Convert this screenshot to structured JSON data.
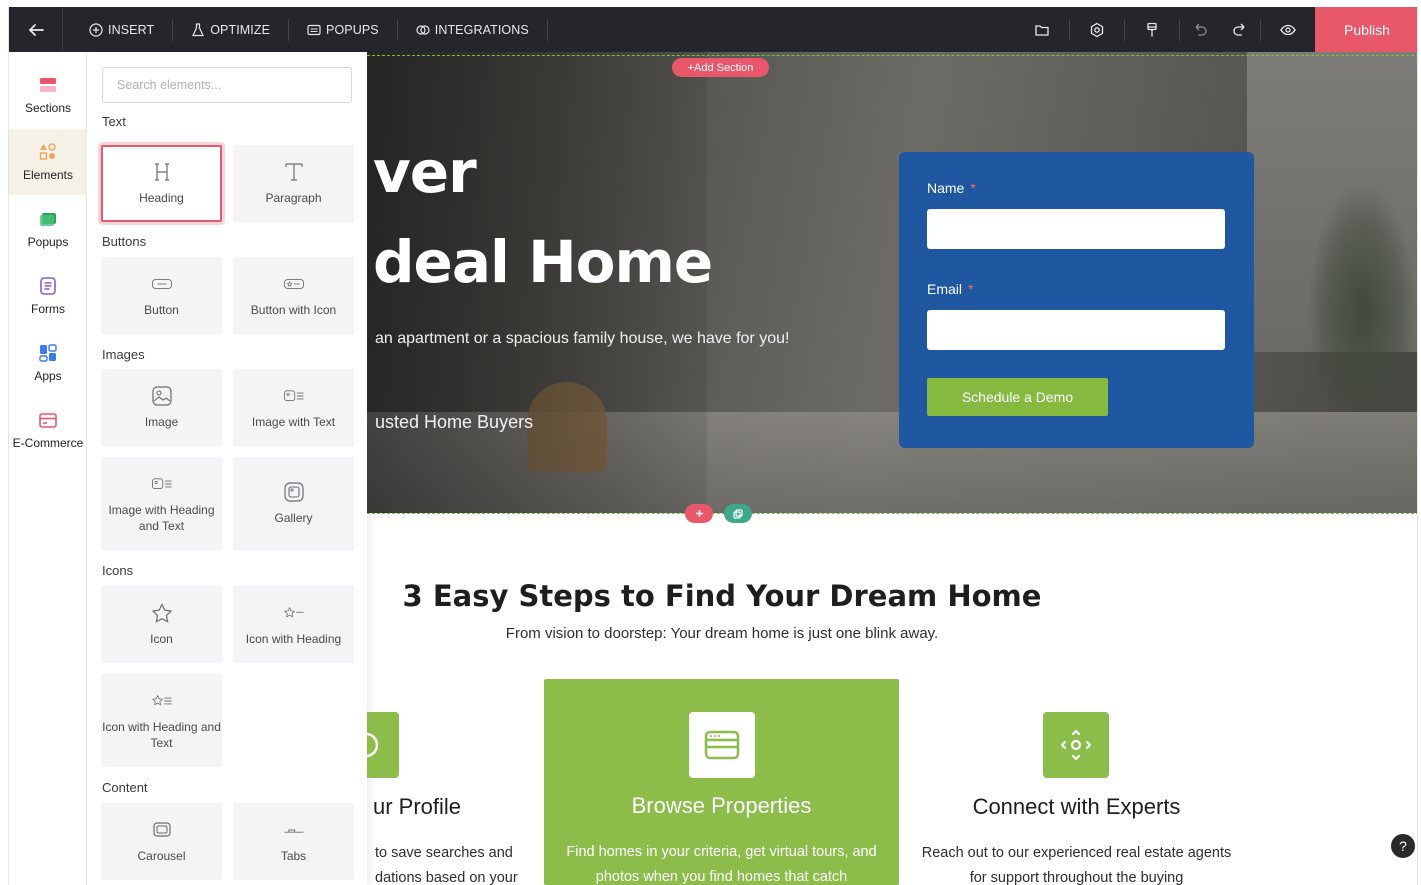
{
  "topbar": {
    "back_icon": "arrow-left-icon",
    "nav": [
      {
        "label": "INSERT",
        "icon": "plus-circle-icon"
      },
      {
        "label": "OPTIMIZE",
        "icon": "flask-icon"
      },
      {
        "label": "POPUPS",
        "icon": "window-icon"
      },
      {
        "label": "INTEGRATIONS",
        "icon": "link-icon"
      }
    ],
    "tools": [
      "folder-icon",
      "settings-icon",
      "paint-brush-icon",
      "undo-icon",
      "redo-icon",
      "eye-icon"
    ],
    "publish_label": "Publish",
    "accent": "#e8586a"
  },
  "rail": {
    "items": [
      {
        "label": "Sections",
        "icon": "sections-icon"
      },
      {
        "label": "Elements",
        "icon": "shapes-icon",
        "active": true
      },
      {
        "label": "Popups",
        "icon": "popups-icon"
      },
      {
        "label": "Forms",
        "icon": "forms-icon"
      },
      {
        "label": "Apps",
        "icon": "apps-icon"
      },
      {
        "label": "E-Commerce",
        "icon": "ecommerce-icon"
      }
    ]
  },
  "panel": {
    "search_placeholder": "Search elements...",
    "categories": {
      "text": "Text",
      "buttons": "Buttons",
      "images": "Images",
      "icons": "Icons",
      "content": "Content"
    },
    "elements": {
      "heading": "Heading",
      "paragraph": "Paragraph",
      "button": "Button",
      "button_icon": "Button with Icon",
      "image": "Image",
      "image_text": "Image with Text",
      "image_heading_text": "Image with Heading and Text",
      "gallery": "Gallery",
      "icon": "Icon",
      "icon_heading": "Icon with Heading",
      "icon_heading_text": "Icon with Heading and Text",
      "carousel": "Carousel",
      "tabs": "Tabs"
    }
  },
  "canvas": {
    "add_section_label": "+Add Section",
    "hero": {
      "line1": "ver",
      "line2": "deal Home",
      "subtitle": "an apartment or a spacious family house, we have for you!",
      "trust": "usted Home Buyers"
    },
    "form": {
      "name_label": "Name",
      "email_label": "Email",
      "required_mark": "*",
      "button_label": "Schedule a Demo"
    },
    "steps": {
      "title": "3 Easy Steps to Find Your Dream Home",
      "subtitle": "From vision to doorstep: Your dream home is just one blink away.",
      "items": [
        {
          "title": "ur Profile",
          "text": "to save searches and dations based on your"
        },
        {
          "title": "Browse Properties",
          "text": "Find homes in your criteria, get virtual tours, and photos when you find homes that catch"
        },
        {
          "title": "Connect with Experts",
          "text": "Reach out to our experienced real estate agents for support throughout the buying"
        }
      ]
    },
    "help_label": "?"
  }
}
